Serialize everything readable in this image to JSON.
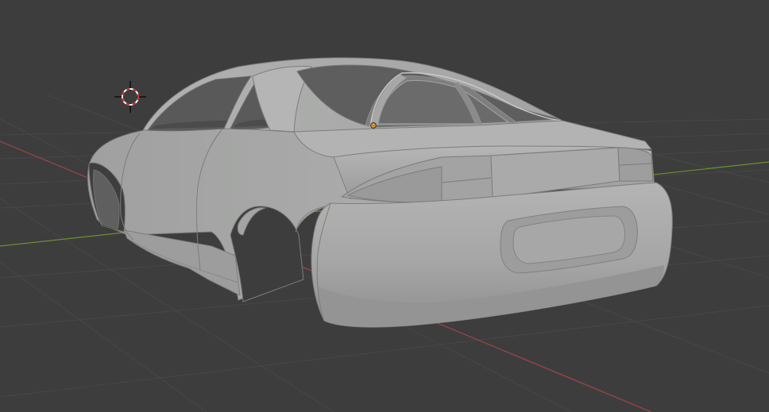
{
  "viewport": {
    "mode": "3d-viewport-solid-shading",
    "background_color": "#3d3d3d",
    "grid_color": "#4a4a4a",
    "x_axis_color": "#a2444c",
    "y_axis_color": "#6e8f2e"
  },
  "scene": {
    "mesh_object": "car-body-mesh",
    "mesh_color": "#a9aaa9",
    "cursor_icon": "3d-cursor-icon",
    "origin_icon": "object-origin-icon",
    "origin_color": "#e59a2c"
  }
}
